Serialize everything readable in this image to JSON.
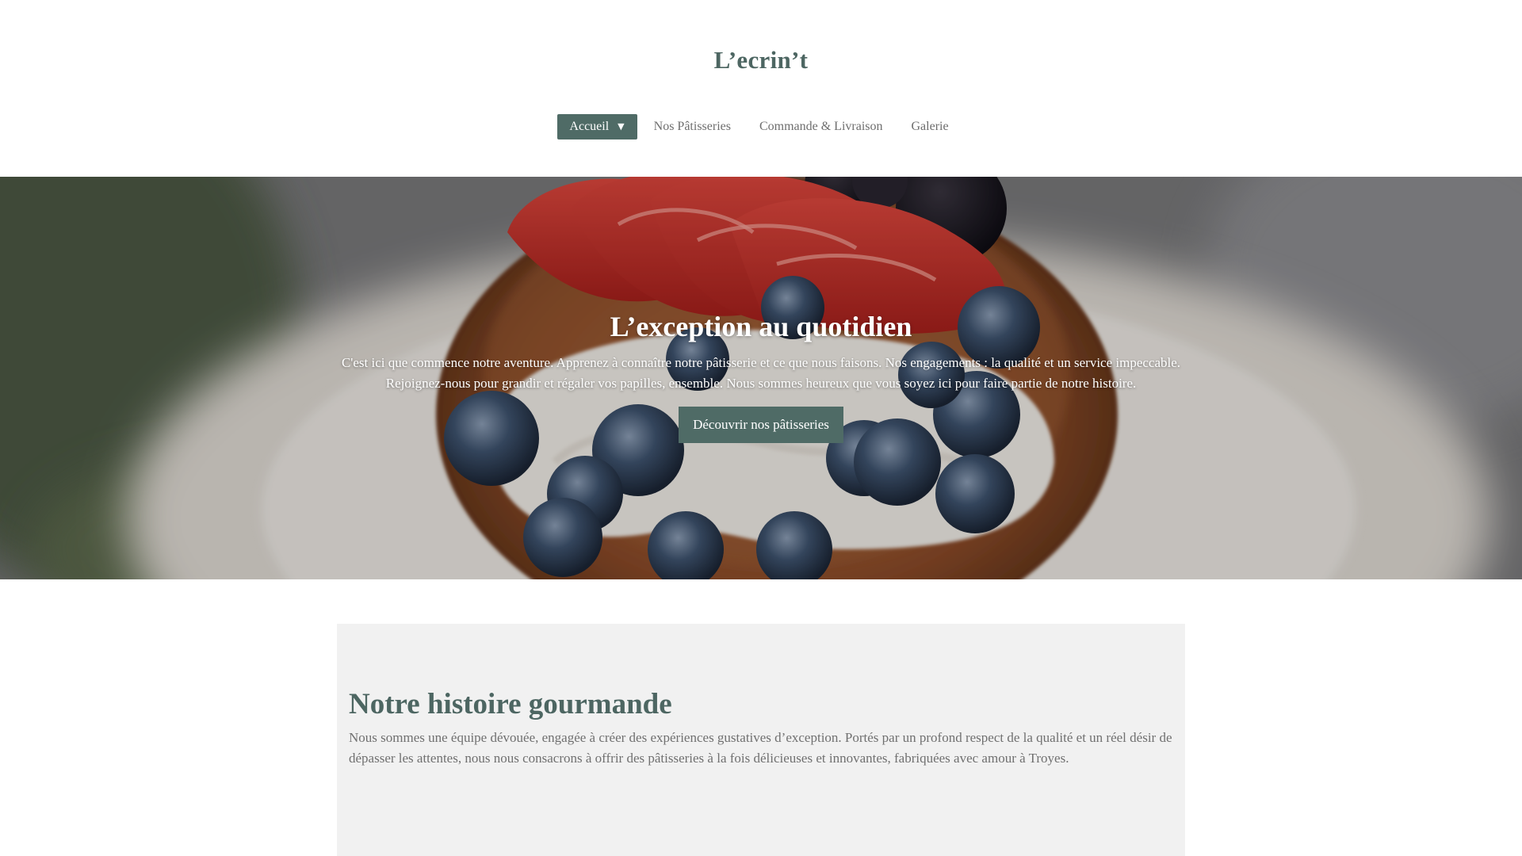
{
  "site": {
    "title": "L’ecrin’t"
  },
  "nav": {
    "items": [
      {
        "label": "Accueil",
        "active": true,
        "caret": "▼"
      },
      {
        "label": "Nos Pâtisseries",
        "active": false
      },
      {
        "label": "Commande & Livraison",
        "active": false
      },
      {
        "label": "Galerie",
        "active": false
      }
    ]
  },
  "hero": {
    "title": "L’exception au quotidien",
    "text_line1": "C'est ici que commence notre aventure. Apprenez à connaître notre pâtisserie et ce que nous faisons. Nos engagements : la qualité et un service impeccable.",
    "text_line2": "Rejoignez-nous pour grandir et régaler vos papilles, ensemble. Nous sommes heureux que vous soyez ici pour faire partie de notre histoire.",
    "button_label": "Découvrir nos pâtisseries",
    "image": "pastry-berries-photo"
  },
  "story": {
    "title": "Notre histoire gourmande",
    "text": "Nous sommes une équipe dévouée, engagée à créer des expériences gustatives d’exception. Portés par un profond respect de la qualité et un réel désir de dépasser les attentes, nous nous consacrons à offrir des pâtisseries à la fois délicieuses et innovantes, fabriquées avec amour à Troyes."
  },
  "colors": {
    "accent": "#4f6b66",
    "heading": "#4d6662",
    "nav_text": "#6e6e6e",
    "story_bg": "#f1f1f1",
    "body_text": "#707070"
  }
}
